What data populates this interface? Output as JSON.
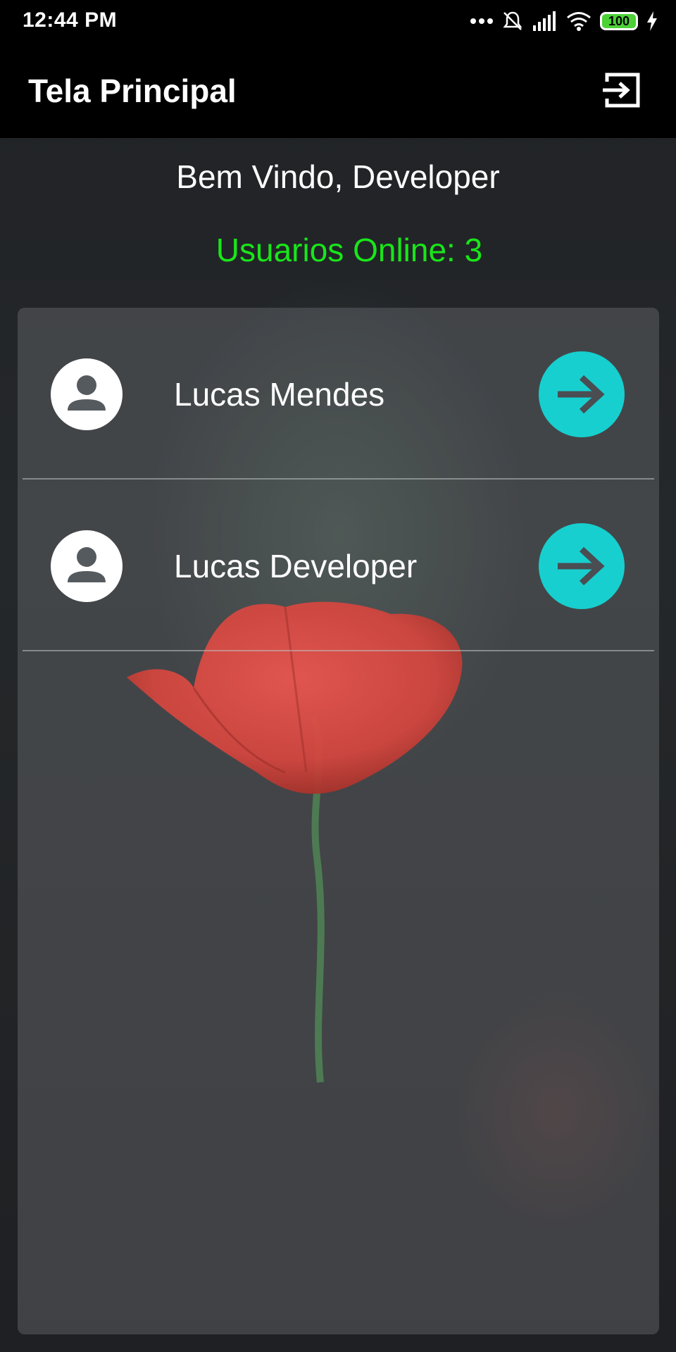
{
  "status_bar": {
    "time": "12:44 PM",
    "battery": "100"
  },
  "app_bar": {
    "title": "Tela Principal"
  },
  "welcome": "Bem Vindo, Developer",
  "online_label": "Usuarios Online: 3",
  "colors": {
    "online_text": "#19e619",
    "accent": "#17cfcf"
  },
  "users": [
    {
      "name": "Lucas Mendes"
    },
    {
      "name": "Lucas Developer"
    }
  ]
}
